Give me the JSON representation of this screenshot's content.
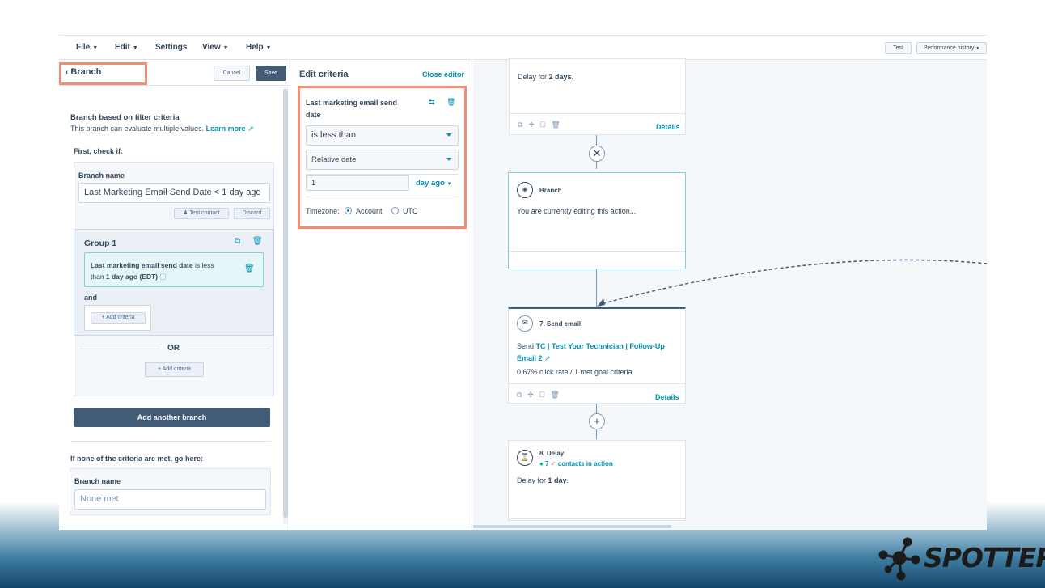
{
  "menu": {
    "items": [
      "File",
      "Edit",
      "Settings",
      "View",
      "Help"
    ],
    "test_label": "Test",
    "performance_label": "Performance history"
  },
  "left": {
    "back_label": "Branch",
    "cancel_label": "Cancel",
    "save_label": "Save",
    "heading": "Branch based on filter criteria",
    "desc": "This branch can evaluate multiple values.",
    "learn_more": "Learn more",
    "first_check": "First, check if:",
    "branch_name_label": "Branch name",
    "branch_name_value": "Last Marketing Email Send Date < 1 day ago",
    "test_contact": "Test contact",
    "discard": "Discard",
    "group_title": "Group 1",
    "criteria_prop": "Last marketing email send date",
    "criteria_op": " is less",
    "criteria_than": "than ",
    "criteria_val": "1 day ago (EDT)",
    "and_label": "and",
    "add_criteria": "Add criteria",
    "or_label": "OR",
    "add_criteria_2": "Add criteria",
    "add_branch": "Add another branch",
    "none_met_heading": "If none of the criteria are met, go here:",
    "none_branch_label": "Branch name",
    "none_placeholder": "None met"
  },
  "edit": {
    "title": "Edit criteria",
    "close": "Close editor",
    "prop_line1": "Last marketing email send",
    "prop_line2": "date",
    "operator": "is less than",
    "date_type": "Relative date",
    "number": "1",
    "unit": "day ago",
    "timezone_label": "Timezone:",
    "tz_account": "Account",
    "tz_utc": "UTC"
  },
  "canvas": {
    "delay_top_pre": "Delay for ",
    "delay_top_val": "2 days",
    "delay_top_post": ".",
    "details_label": "Details",
    "branch_title": "Branch",
    "branch_text": "You are currently editing this action...",
    "send_title": "7. Send email",
    "send_pre": "Send ",
    "send_link": "TC | Test Your Technician | Follow-Up",
    "send_link2": "Email 2",
    "send_stats": "0.67% click rate / 1 met goal criteria",
    "details_label_2": "Details",
    "delay_title": "8. Delay",
    "delay_count": "7",
    "delay_contacts": "contacts in action",
    "delay_pre": "Delay for ",
    "delay_val": "1 day",
    "delay_post": "."
  },
  "logo": {
    "text": "SPOTTER"
  },
  "colors": {
    "highlight": "#ef8d75",
    "accent": "#0091ae",
    "primary_button": "#425b76"
  }
}
